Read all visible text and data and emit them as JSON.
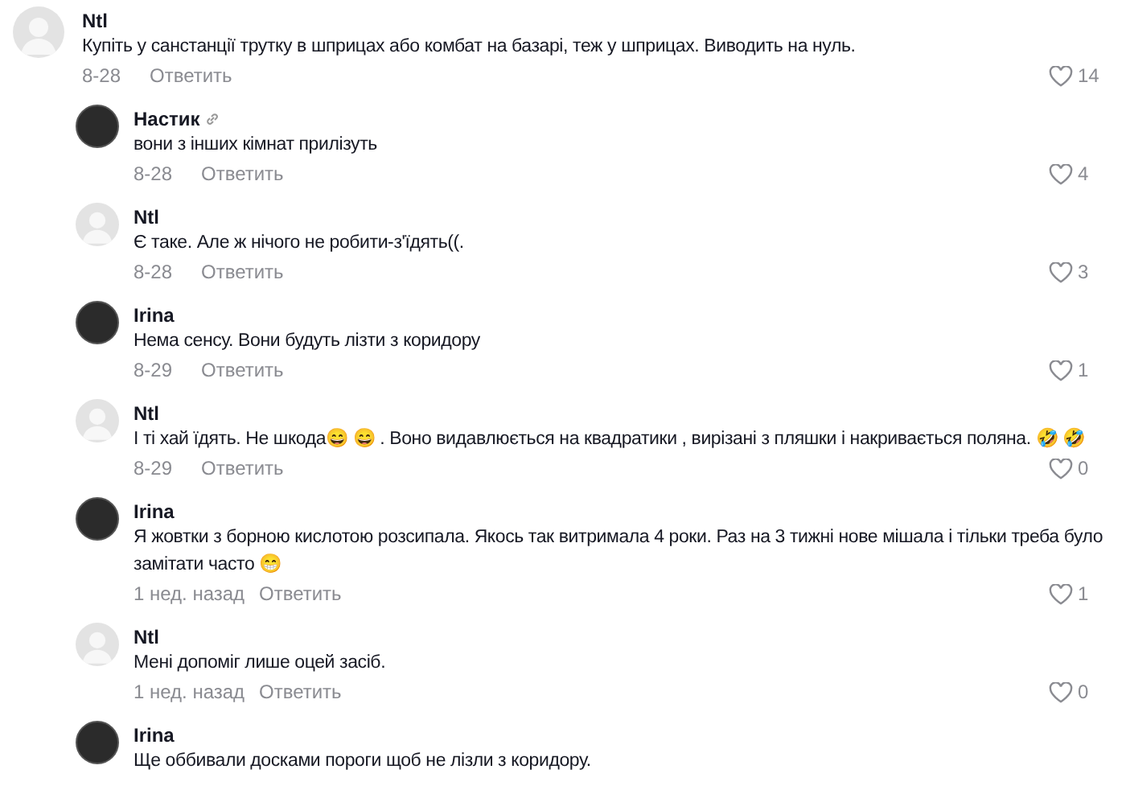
{
  "comments": [
    {
      "author": "Ntl",
      "default_avatar": true,
      "link_badge": false,
      "text": "Купіть у санстанції трутку в шприцах або комбат на базарі, теж у шприцах. Виводить на нуль.",
      "time": "8-28",
      "reply_label": "Ответить",
      "likes": "14",
      "children": [
        {
          "author": "Настик",
          "default_avatar": false,
          "link_badge": true,
          "text": "вони з інших кімнат прилізуть",
          "time": "8-28",
          "reply_label": "Ответить",
          "likes": "4"
        },
        {
          "author": "Ntl",
          "default_avatar": true,
          "link_badge": false,
          "text": "Є таке. Але ж нічого не робити-з'їдять((.",
          "time": "8-28",
          "reply_label": "Ответить",
          "likes": "3"
        },
        {
          "author": "Irina",
          "default_avatar": false,
          "link_badge": false,
          "text": "Нема сенсу. Вони будуть лізти з коридору",
          "time": "8-29",
          "reply_label": "Ответить",
          "likes": "1"
        },
        {
          "author": "Ntl",
          "default_avatar": true,
          "link_badge": false,
          "text": "І ті хай їдять. Не шкода😄 😄 . Воно видавлюється на квадратики , вирізані з пляшки і накривається поляна. 🤣 🤣",
          "time": "8-29",
          "reply_label": "Ответить",
          "likes": "0"
        },
        {
          "author": "Irina",
          "default_avatar": false,
          "link_badge": false,
          "text": "Я жовтки з борною кислотою розсипала. Якось так витримала 4 роки. Раз на 3 тижні нове мішала і тільки треба було замітати часто 😁",
          "time": "1 нед. назад",
          "reply_label": "Ответить",
          "likes": "1"
        },
        {
          "author": "Ntl",
          "default_avatar": true,
          "link_badge": false,
          "text": "Мені допоміг лише оцей засіб.",
          "time": "1 нед. назад",
          "reply_label": "Ответить",
          "likes": "0"
        },
        {
          "author": "Irina",
          "default_avatar": false,
          "link_badge": false,
          "text": "Ще оббивали досками пороги щоб не лізли з коридору."
        }
      ]
    }
  ]
}
